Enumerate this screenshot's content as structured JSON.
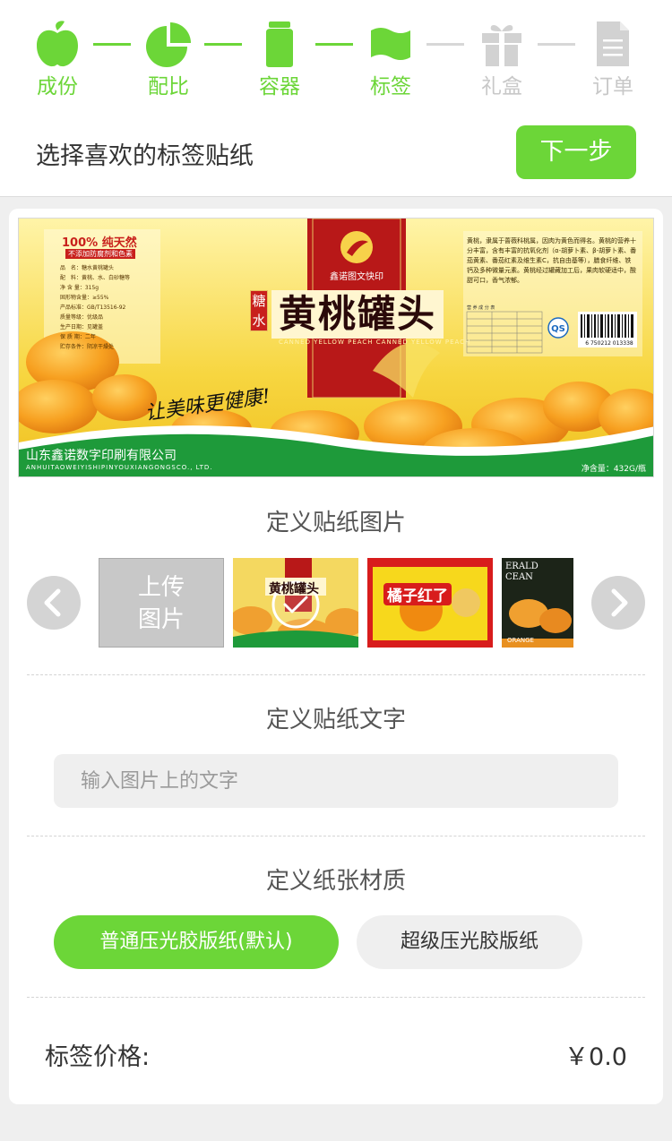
{
  "steps": [
    {
      "label": "成份",
      "icon": "apple-icon",
      "active": true
    },
    {
      "label": "配比",
      "icon": "pie-chart-icon",
      "active": true
    },
    {
      "label": "容器",
      "icon": "jar-icon",
      "active": true
    },
    {
      "label": "标签",
      "icon": "flag-icon",
      "active": true
    },
    {
      "label": "礼盒",
      "icon": "gift-icon",
      "active": false
    },
    {
      "label": "订单",
      "icon": "document-icon",
      "active": false
    }
  ],
  "header": {
    "title": "选择喜欢的标签贴纸",
    "next_label": "下一步"
  },
  "preview": {
    "natural": "100% 纯天然",
    "natural_sub": "不添加防腐剂和色素",
    "specs": [
      "品　名：糖水黄桃罐头",
      "配　料：黄桃、水、白砂糖等",
      "净 含 量：315g",
      "固形物含量：≥55%",
      "产品标准：GB/T13516-92",
      "质量等级：优级品",
      "生产日期：见罐盖",
      "保 质 期：二年",
      "贮存条件：阴凉干燥处"
    ],
    "brand": "鑫诺图文快印",
    "product_prefix": "糖水",
    "product_name": "黄桃罐头",
    "product_en": "CANNED YELLOW PEACH CANNED YELLOW PEACH",
    "slogan": "让美味更健康!",
    "desc": "黄桃，隶属于蔷薇科桃属，因肉为黄色而得名。黄桃的营养十分丰富，含有丰富的抗氧化剂（α-胡萝卜素、β-胡萝卜素、番茄黄素、番茄红素及维生素C，抗自由基等），膳食纤维、铁钙及多种微量元素。黄桃经过罐藏加工后，果肉软硬适中，酸甜可口，香气浓郁。",
    "nutrition_title": "营 养 成 分 表",
    "barcode": "6 750212 013338",
    "company": "山东鑫诺数字印刷有限公司",
    "company_en": "ANHUITAOWEIYISHIPINYOUXIANGONGSCO., LTD.",
    "net": "净含量：432G/瓶"
  },
  "image_section": {
    "title": "定义贴纸图片",
    "upload_line1": "上传",
    "upload_line2": "图片",
    "thumb2_text": "橘子红了",
    "thumb3_text1": "ERALD",
    "thumb3_text2": "CEAN",
    "thumb3_text3": "ORANGE"
  },
  "text_section": {
    "title": "定义贴纸文字",
    "placeholder": "输入图片上的文字",
    "value": ""
  },
  "paper_section": {
    "title": "定义纸张材质",
    "options": [
      {
        "label": "普通压光胶版纸(默认)",
        "selected": true
      },
      {
        "label": "超级压光胶版纸",
        "selected": false
      }
    ]
  },
  "price": {
    "label": "标签价格:",
    "value": "￥0.0"
  },
  "colors": {
    "accent": "#6cd638",
    "inactive": "#d7d7d7"
  }
}
